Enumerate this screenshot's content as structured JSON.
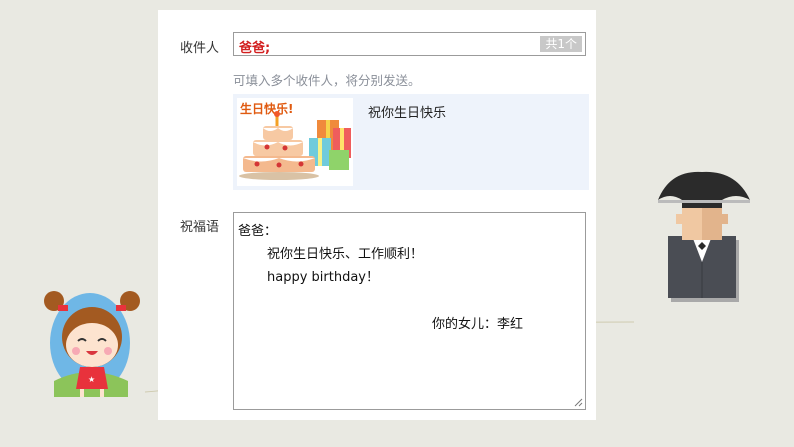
{
  "form": {
    "recipient_label": "收件人",
    "recipient_value": "爸爸;",
    "recipient_count": "共1个",
    "hint": "可填入多个收件人，将分别发送。",
    "card": {
      "image_text": "生日快乐!",
      "title": "祝你生日快乐"
    },
    "message_label": "祝福语",
    "message": {
      "line1": "爸爸：",
      "line2": "祝你生日快乐、工作顺利！",
      "line3": "happy birthday！",
      "line4": "你的女儿：李红"
    }
  },
  "colors": {
    "background": "#e9e9e2",
    "recipient_text": "#d21f1f",
    "preview_bg": "#eef3fb"
  },
  "icons": [
    "birthday-card-image",
    "resize-grip-icon",
    "girl-illustration",
    "father-illustration"
  ]
}
